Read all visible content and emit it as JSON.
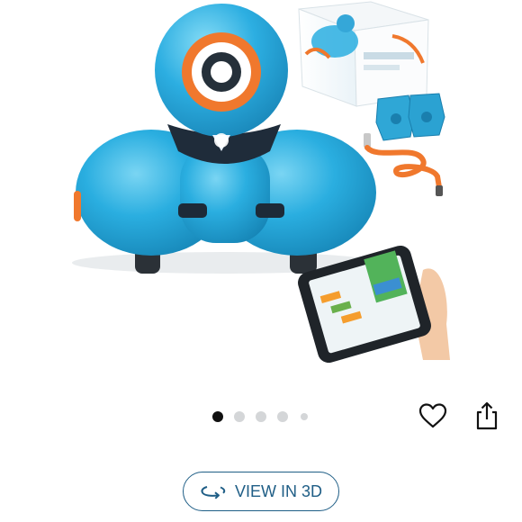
{
  "product_image": {
    "alt": ""
  },
  "carousel": {
    "total": 5,
    "active_index": 0
  },
  "actions": {
    "favorite_icon": "heart-outline-icon",
    "share_icon": "share-icon"
  },
  "view_3d": {
    "label": "VIEW IN 3D",
    "icon": "rotate-3d-icon"
  },
  "colors": {
    "robot_blue": "#2aaee0",
    "accent_orange": "#f0782d",
    "link_blue": "#1f5e86"
  }
}
